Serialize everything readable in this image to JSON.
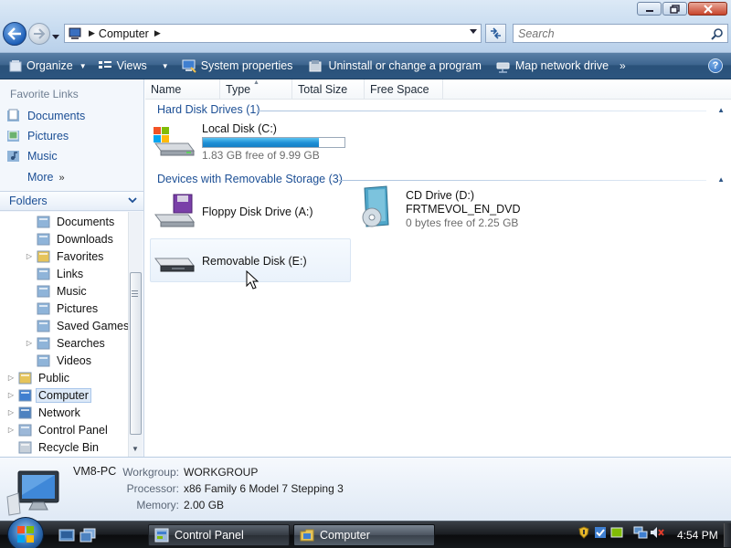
{
  "window": {
    "controls": [
      "minimize-icon",
      "maximize-icon",
      "close-icon"
    ]
  },
  "address_bar": {
    "location": "Computer",
    "search_placeholder": "Search"
  },
  "command_bar": {
    "organize": "Organize",
    "views": "Views",
    "system_properties": "System properties",
    "uninstall": "Uninstall or change a program",
    "map_network_drive": "Map network drive",
    "help": "?"
  },
  "favorites": {
    "header": "Favorite Links",
    "items": [
      "Documents",
      "Pictures",
      "Music"
    ],
    "more": "More"
  },
  "folders": {
    "header": "Folders",
    "tree": [
      {
        "label": "Documents",
        "icon": "documents-folder-icon",
        "expandable": false
      },
      {
        "label": "Downloads",
        "icon": "downloads-folder-icon",
        "expandable": false
      },
      {
        "label": "Favorites",
        "icon": "favorites-folder-icon",
        "expandable": true
      },
      {
        "label": "Links",
        "icon": "links-folder-icon",
        "expandable": false
      },
      {
        "label": "Music",
        "icon": "music-folder-icon",
        "expandable": false
      },
      {
        "label": "Pictures",
        "icon": "pictures-folder-icon",
        "expandable": false
      },
      {
        "label": "Saved Games",
        "icon": "saved-games-folder-icon",
        "expandable": false
      },
      {
        "label": "Searches",
        "icon": "searches-folder-icon",
        "expandable": true
      },
      {
        "label": "Videos",
        "icon": "videos-folder-icon",
        "expandable": false
      },
      {
        "label": "Public",
        "icon": "public-folder-icon",
        "expandable": true
      },
      {
        "label": "Computer",
        "icon": "computer-icon",
        "expandable": true,
        "selected": true
      },
      {
        "label": "Network",
        "icon": "network-icon",
        "expandable": true
      },
      {
        "label": "Control Panel",
        "icon": "control-panel-icon",
        "expandable": true
      },
      {
        "label": "Recycle Bin",
        "icon": "recycle-bin-icon",
        "expandable": false
      }
    ]
  },
  "columns": [
    "Name",
    "Type",
    "Total Size",
    "Free Space"
  ],
  "groups": {
    "hard_disks": {
      "title": "Hard Disk Drives (1)",
      "drives": [
        {
          "name": "Local Disk (C:)",
          "free": "1.83 GB free of 9.99 GB",
          "used_fraction": 0.817
        }
      ]
    },
    "removable": {
      "title": "Devices with Removable Storage (3)",
      "floppy": {
        "name": "Floppy Disk Drive (A:)"
      },
      "cd": {
        "name": "CD Drive (D:)",
        "label": "FRTMEVOL_EN_DVD",
        "free": "0 bytes free of 2.25 GB"
      },
      "usb": {
        "name": "Removable Disk (E:)"
      }
    }
  },
  "details": {
    "computer_name": "VM8-PC",
    "workgroup_label": "Workgroup:",
    "workgroup": "WORKGROUP",
    "processor_label": "Processor:",
    "processor": "x86 Family 6 Model 7 Stepping 3",
    "memory_label": "Memory:",
    "memory": "2.00 GB"
  },
  "taskbar": {
    "buttons": [
      {
        "label": "Control Panel",
        "active": false
      },
      {
        "label": "Computer",
        "active": true
      }
    ],
    "clock": "4:54 PM"
  },
  "colors": {
    "accent_link": "#1c4f95",
    "command_bar": "#2c557f",
    "capacity_fill": "#1e8fd6"
  }
}
